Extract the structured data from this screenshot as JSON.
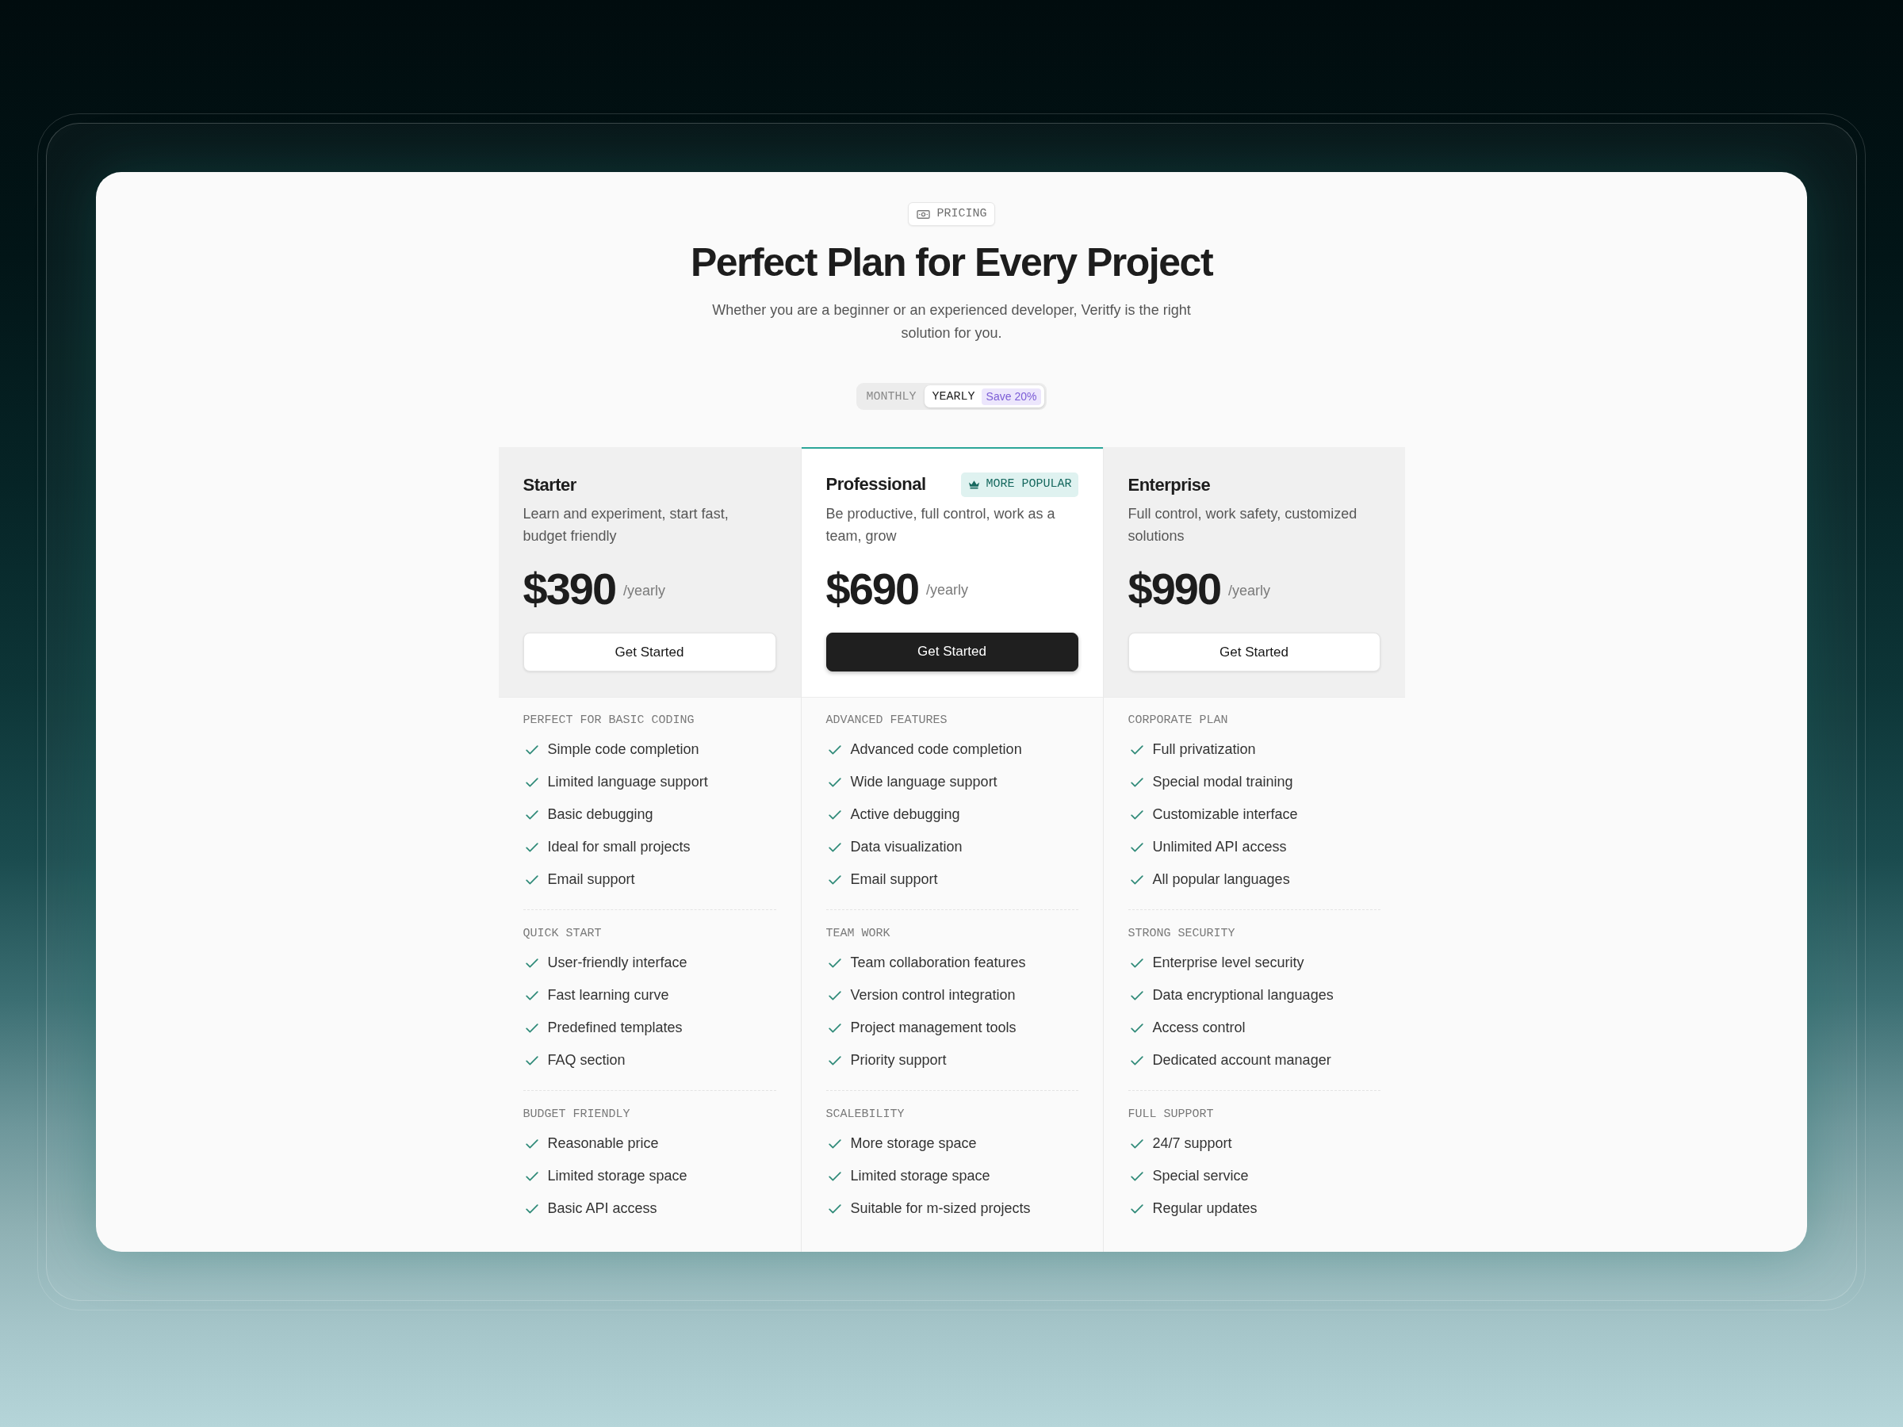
{
  "badge": {
    "label": "PRICING"
  },
  "title": "Perfect Plan for Every Project",
  "subtitle": "Whether you are a beginner or an experienced developer, Veritfy is the right solution for you.",
  "billing_toggle": {
    "options": [
      {
        "label": "MONTHLY",
        "selected": false
      },
      {
        "label": "YEARLY",
        "selected": true,
        "note": "Save 20%"
      }
    ]
  },
  "plans": [
    {
      "name": "Starter",
      "highlighted": false,
      "description": "Learn and experiment, start fast, budget friendly",
      "price": "$390",
      "period": "/yearly",
      "button": "Get Started",
      "feature_groups": [
        {
          "title": "PERFECT FOR BASIC CODING",
          "items": [
            "Simple code completion",
            "Limited language support",
            "Basic debugging",
            "Ideal for small projects",
            "Email support"
          ]
        },
        {
          "title": "QUICK START",
          "items": [
            "User-friendly interface",
            "Fast learning curve",
            "Predefined templates",
            "FAQ section"
          ]
        },
        {
          "title": "BUDGET FRIENDLY",
          "items": [
            "Reasonable price",
            "Limited storage space",
            "Basic API access"
          ]
        }
      ]
    },
    {
      "name": "Professional",
      "highlighted": true,
      "tag": "MORE POPULAR",
      "description": "Be productive, full control, work as a team, grow",
      "price": "$690",
      "period": "/yearly",
      "button": "Get Started",
      "feature_groups": [
        {
          "title": "ADVANCED FEATURES",
          "items": [
            "Advanced code completion",
            "Wide language support",
            "Active debugging",
            "Data visualization",
            "Email support"
          ]
        },
        {
          "title": "TEAM WORK",
          "items": [
            "Team collaboration features",
            "Version control integration",
            "Project management tools",
            "Priority support"
          ]
        },
        {
          "title": "SCALEBILITY",
          "items": [
            "More storage space",
            "Limited storage space",
            "Suitable for m-sized projects"
          ]
        }
      ]
    },
    {
      "name": "Enterprise",
      "highlighted": false,
      "description": "Full control, work safety, customized solutions",
      "price": "$990",
      "period": "/yearly",
      "button": "Get Started",
      "feature_groups": [
        {
          "title": "CORPORATE PLAN",
          "items": [
            "Full privatization",
            "Special modal training",
            "Customizable interface",
            "Unlimited API access",
            "All popular languages"
          ]
        },
        {
          "title": "STRONG SECURITY",
          "items": [
            "Enterprise level security",
            "Data encryptional languages",
            "Access control",
            "Dedicated account manager"
          ]
        },
        {
          "title": "FULL SUPPORT",
          "items": [
            "24/7 support",
            "Special service",
            "Regular updates"
          ]
        }
      ]
    }
  ]
}
